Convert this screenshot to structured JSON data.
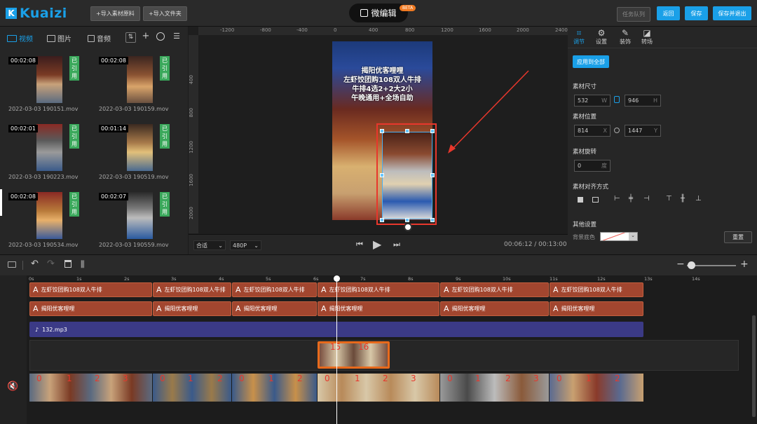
{
  "app": {
    "logo_mark": "K",
    "logo": "Kuaizi",
    "import_material": "+导入素材原料",
    "import_folder": "+导入文件夹",
    "mode_title": "微编辑",
    "beta": "BETA",
    "task_queue": "任务队列",
    "back": "返回",
    "save": "保存",
    "save_exit": "保存并退出"
  },
  "lib": {
    "tabs": [
      {
        "label": "视频",
        "icon": "video-icon"
      },
      {
        "label": "图片",
        "icon": "image-icon"
      },
      {
        "label": "音频",
        "icon": "audio-icon"
      }
    ],
    "items": [
      {
        "duration": "00:02:08",
        "badge": "已引用",
        "name": "2022-03-03 190151.mov"
      },
      {
        "duration": "00:02:08",
        "badge": "已引用",
        "name": "2022-03-03 190159.mov"
      },
      {
        "duration": "00:02:01",
        "badge": "已引用",
        "name": "2022-03-03 190223.mov"
      },
      {
        "duration": "00:01:14",
        "badge": "已引用",
        "name": "2022-03-03 190519.mov"
      },
      {
        "duration": "00:02:08",
        "badge": "已引用",
        "name": "2022-03-03 190534.mov"
      },
      {
        "duration": "00:02:07",
        "badge": "已引用",
        "name": "2022-03-03 190559.mov"
      }
    ]
  },
  "preview": {
    "hruler": [
      "-1200",
      "-800",
      "-400",
      "0",
      "400",
      "800",
      "1200",
      "1600",
      "2000",
      "2400"
    ],
    "vruler": [
      "400",
      "800",
      "1200",
      "1600",
      "2000"
    ],
    "caption": [
      "揭阳优客哩哩",
      "左虾饺团购108双人牛排",
      "牛排4选2+2大2小",
      "午晚通用+全场自助"
    ],
    "fit": "合适",
    "res": "480P",
    "time": "00:06:12 / 00:13:00"
  },
  "right": {
    "tabs": [
      {
        "label": "调节",
        "icon": "crop-icon"
      },
      {
        "label": "设置",
        "icon": "sliders-icon"
      },
      {
        "label": "装饰",
        "icon": "wand-icon"
      },
      {
        "label": "转场",
        "icon": "transition-icon"
      }
    ],
    "apply_all": "应用到全部",
    "size_label": "素材尺寸",
    "w": "532",
    "w_unit": "W",
    "h": "946",
    "h_unit": "H",
    "pos_label": "素材位置",
    "x": "814",
    "x_unit": "X",
    "y": "1447",
    "y_unit": "Y",
    "rot_label": "素材旋转",
    "rot": "0",
    "rot_unit": "度",
    "align_label": "素材对齐方式",
    "other_label": "其他设置",
    "bg_label": "背景底色",
    "reset": "重置"
  },
  "timeline": {
    "ruler": [
      "0s",
      "1s",
      "2s",
      "3s",
      "4s",
      "5s",
      "6s",
      "7s",
      "8s",
      "9s",
      "10s",
      "11s",
      "12s",
      "13s",
      "14s"
    ],
    "text1": "左虾饺团购108双人牛排",
    "text2": "揭阳优客哩哩",
    "audio": "132.mp3",
    "overlay_nums": [
      "15",
      "16"
    ],
    "segs": [
      {
        "nums": [
          "0",
          "1",
          "2",
          "3"
        ]
      },
      {
        "nums": [
          "0",
          "1",
          "2"
        ]
      },
      {
        "nums": [
          "0",
          "1",
          "2"
        ]
      },
      {
        "nums": [
          "0",
          "1",
          "2",
          "3"
        ]
      },
      {
        "nums": [
          "0",
          "1",
          "2",
          "3"
        ]
      },
      {
        "nums": [
          "0",
          "1",
          "2"
        ]
      }
    ]
  },
  "colors": {
    "accent": "#1aa0e8",
    "used": "#3aa85b",
    "text_clip": "#a2462f",
    "audio": "#3b3a86",
    "select": "#e8372c"
  }
}
